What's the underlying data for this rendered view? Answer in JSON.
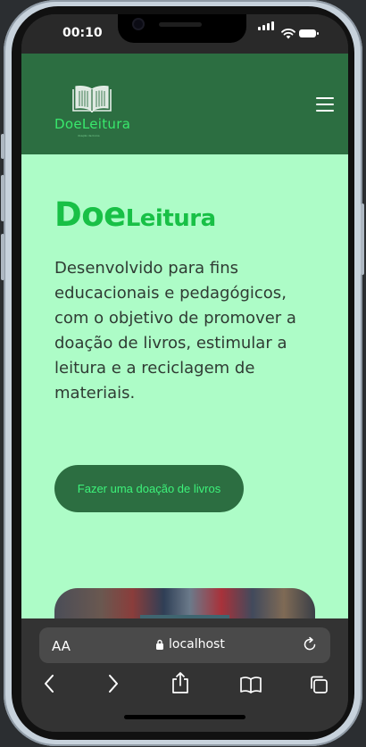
{
  "status_bar": {
    "time": "00:10"
  },
  "app_header": {
    "logo_text": "DoeLeitura",
    "logo_tagline": "doação de livros",
    "menu_icon": "hamburger-menu-icon"
  },
  "hero": {
    "title_part1": "Doe",
    "title_part2": "Leitura",
    "description": "Desenvolvido para fins educacionais e pedagógicos, com o objetivo de promover a doação de livros, estimular a leitura e a reciclagem de materiais.",
    "cta_label": "Fazer uma doação de livros",
    "image": "books-shelf-photo"
  },
  "browser": {
    "text_size_label": "AA",
    "url": "localhost",
    "icons": [
      "lock-icon",
      "reload-icon",
      "back-icon",
      "forward-icon",
      "share-icon",
      "bookmarks-icon",
      "tabs-icon"
    ]
  },
  "colors": {
    "header_bg": "#2c6e41",
    "hero_bg": "#adfcc7",
    "title_green": "#18c046",
    "cta_text": "#3df27a"
  }
}
